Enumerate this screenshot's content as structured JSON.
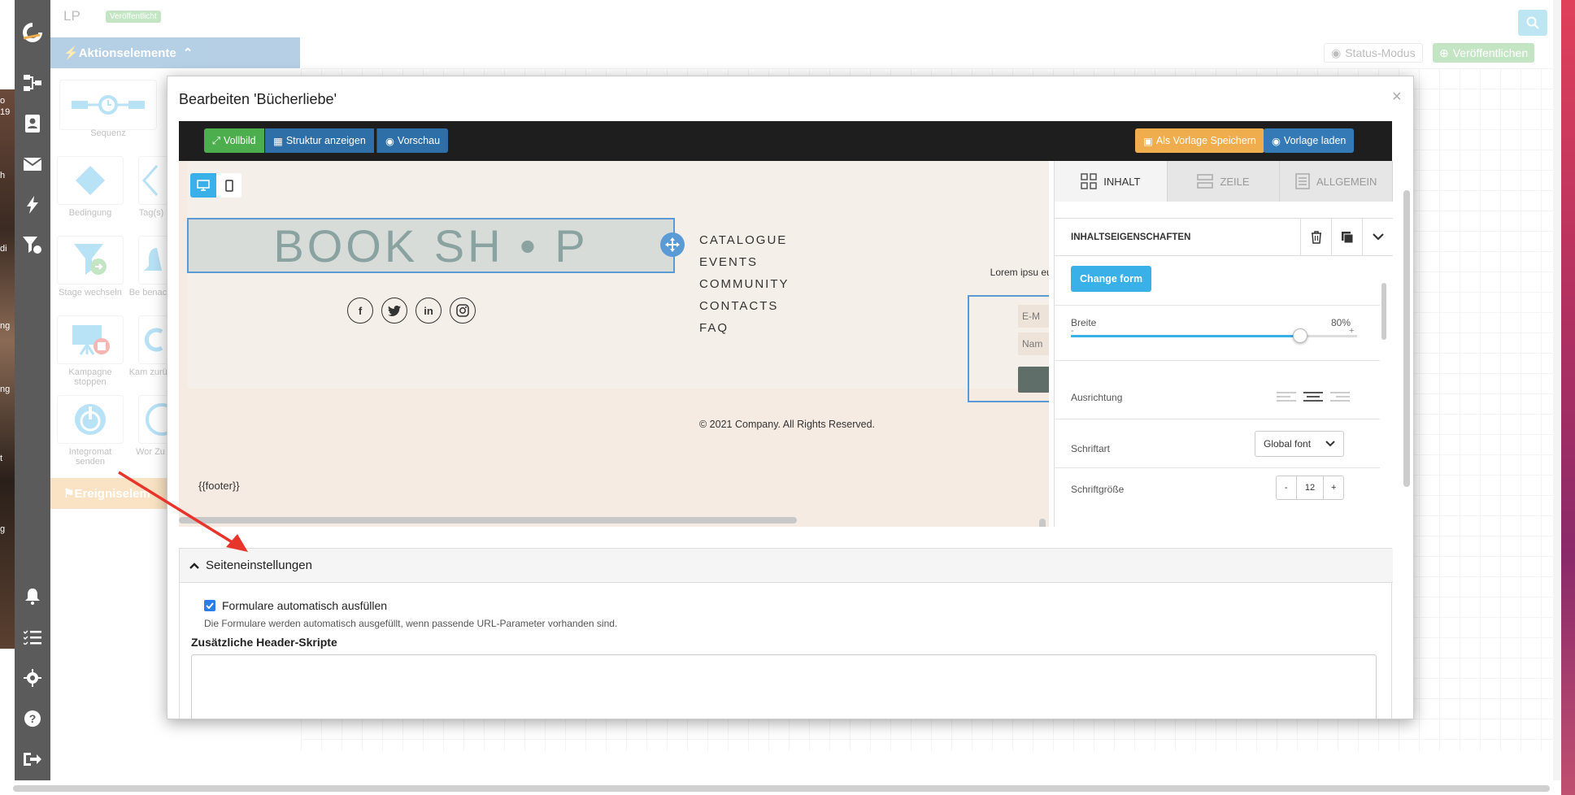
{
  "app": {
    "title": "LP",
    "status_badge": "Veröffentlicht",
    "status_mode_label": "Status-Modus",
    "publish_label": "Veröffentlichen"
  },
  "photo_fragments": [
    "o",
    "19",
    "h",
    "di",
    "ng",
    "ng",
    "t",
    "g"
  ],
  "sidebar": {
    "icons": [
      "logo-icon",
      "flow-icon",
      "contacts-icon",
      "mail-icon",
      "lightning-icon",
      "filter-icon",
      "bell-icon",
      "checklist-icon",
      "gear-icon",
      "help-icon",
      "logout-icon"
    ]
  },
  "palette": {
    "action_header": "Aktionselemente",
    "event_header": "Ereigniselem",
    "tools": [
      {
        "label": "Sequenz"
      },
      {
        "label": "Bedingung"
      },
      {
        "label": "Tag(s)"
      },
      {
        "label": "Stage wechseln"
      },
      {
        "label": "Be benach"
      },
      {
        "label": "Kampagne stoppen"
      },
      {
        "label": "Kam zurüc"
      },
      {
        "label": "Integromat senden"
      },
      {
        "label": "Wor Zu"
      }
    ]
  },
  "modal": {
    "title": "Bearbeiten 'Bücherliebe'",
    "close": "×",
    "toolbar": {
      "fullscreen": "Vollbild",
      "structure": "Struktur anzeigen",
      "preview": "Vorschau",
      "save_template": "Als Vorlage Speichern",
      "load_template": "Vorlage laden"
    },
    "canvas": {
      "logo": "BOOK SH • P",
      "menu": [
        "CATALOGUE",
        "EVENTS",
        "COMMUNITY",
        "CONTACTS",
        "FAQ"
      ],
      "social": [
        "f",
        "t",
        "in",
        "ig"
      ],
      "lorem": "Lorem ipsu euis",
      "form_fields": [
        "E-M",
        "Nam"
      ],
      "copyright": "© 2021 Company. All Rights Reserved.",
      "footer_tag": "{{footer}}"
    },
    "panel": {
      "tabs": [
        "INHALT",
        "ZEILE",
        "ALLGEMEIN"
      ],
      "active_tab": "INHALT",
      "props_title": "INHALTSEIGENSCHAFTEN",
      "change_form": "Change form",
      "width_label": "Breite",
      "width_value": "80%",
      "width_fraction": 0.8,
      "minus": "-",
      "plus": "+",
      "align_label": "Ausrichtung",
      "font_label": "Schriftart",
      "font_value": "Global font",
      "size_label": "Schriftgröße",
      "size_value": "12"
    },
    "settings": {
      "title": "Seiteneinstellungen",
      "autofill_label": "Formulare automatisch ausfüllen",
      "autofill_checked": true,
      "autofill_help": "Die Formulare werden automatisch ausgefüllt, wenn passende URL-Parameter vorhanden sind.",
      "header_scripts_label": "Zusätzliche Header-Skripte",
      "header_scripts_value": ""
    }
  },
  "colors": {
    "success": "#5cb85c",
    "primary": "#337ab7",
    "warning": "#f0ad4e",
    "info": "#3ab0e8",
    "arrow": "#e8352b"
  }
}
